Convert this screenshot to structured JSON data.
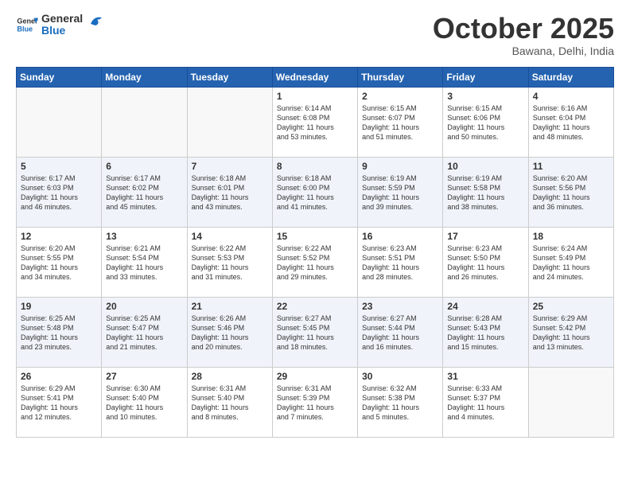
{
  "logo": {
    "text_general": "General",
    "text_blue": "Blue"
  },
  "header": {
    "month": "October 2025",
    "location": "Bawana, Delhi, India"
  },
  "weekdays": [
    "Sunday",
    "Monday",
    "Tuesday",
    "Wednesday",
    "Thursday",
    "Friday",
    "Saturday"
  ],
  "weeks": [
    [
      {
        "day": "",
        "text": ""
      },
      {
        "day": "",
        "text": ""
      },
      {
        "day": "",
        "text": ""
      },
      {
        "day": "1",
        "text": "Sunrise: 6:14 AM\nSunset: 6:08 PM\nDaylight: 11 hours\nand 53 minutes."
      },
      {
        "day": "2",
        "text": "Sunrise: 6:15 AM\nSunset: 6:07 PM\nDaylight: 11 hours\nand 51 minutes."
      },
      {
        "day": "3",
        "text": "Sunrise: 6:15 AM\nSunset: 6:06 PM\nDaylight: 11 hours\nand 50 minutes."
      },
      {
        "day": "4",
        "text": "Sunrise: 6:16 AM\nSunset: 6:04 PM\nDaylight: 11 hours\nand 48 minutes."
      }
    ],
    [
      {
        "day": "5",
        "text": "Sunrise: 6:17 AM\nSunset: 6:03 PM\nDaylight: 11 hours\nand 46 minutes."
      },
      {
        "day": "6",
        "text": "Sunrise: 6:17 AM\nSunset: 6:02 PM\nDaylight: 11 hours\nand 45 minutes."
      },
      {
        "day": "7",
        "text": "Sunrise: 6:18 AM\nSunset: 6:01 PM\nDaylight: 11 hours\nand 43 minutes."
      },
      {
        "day": "8",
        "text": "Sunrise: 6:18 AM\nSunset: 6:00 PM\nDaylight: 11 hours\nand 41 minutes."
      },
      {
        "day": "9",
        "text": "Sunrise: 6:19 AM\nSunset: 5:59 PM\nDaylight: 11 hours\nand 39 minutes."
      },
      {
        "day": "10",
        "text": "Sunrise: 6:19 AM\nSunset: 5:58 PM\nDaylight: 11 hours\nand 38 minutes."
      },
      {
        "day": "11",
        "text": "Sunrise: 6:20 AM\nSunset: 5:56 PM\nDaylight: 11 hours\nand 36 minutes."
      }
    ],
    [
      {
        "day": "12",
        "text": "Sunrise: 6:20 AM\nSunset: 5:55 PM\nDaylight: 11 hours\nand 34 minutes."
      },
      {
        "day": "13",
        "text": "Sunrise: 6:21 AM\nSunset: 5:54 PM\nDaylight: 11 hours\nand 33 minutes."
      },
      {
        "day": "14",
        "text": "Sunrise: 6:22 AM\nSunset: 5:53 PM\nDaylight: 11 hours\nand 31 minutes."
      },
      {
        "day": "15",
        "text": "Sunrise: 6:22 AM\nSunset: 5:52 PM\nDaylight: 11 hours\nand 29 minutes."
      },
      {
        "day": "16",
        "text": "Sunrise: 6:23 AM\nSunset: 5:51 PM\nDaylight: 11 hours\nand 28 minutes."
      },
      {
        "day": "17",
        "text": "Sunrise: 6:23 AM\nSunset: 5:50 PM\nDaylight: 11 hours\nand 26 minutes."
      },
      {
        "day": "18",
        "text": "Sunrise: 6:24 AM\nSunset: 5:49 PM\nDaylight: 11 hours\nand 24 minutes."
      }
    ],
    [
      {
        "day": "19",
        "text": "Sunrise: 6:25 AM\nSunset: 5:48 PM\nDaylight: 11 hours\nand 23 minutes."
      },
      {
        "day": "20",
        "text": "Sunrise: 6:25 AM\nSunset: 5:47 PM\nDaylight: 11 hours\nand 21 minutes."
      },
      {
        "day": "21",
        "text": "Sunrise: 6:26 AM\nSunset: 5:46 PM\nDaylight: 11 hours\nand 20 minutes."
      },
      {
        "day": "22",
        "text": "Sunrise: 6:27 AM\nSunset: 5:45 PM\nDaylight: 11 hours\nand 18 minutes."
      },
      {
        "day": "23",
        "text": "Sunrise: 6:27 AM\nSunset: 5:44 PM\nDaylight: 11 hours\nand 16 minutes."
      },
      {
        "day": "24",
        "text": "Sunrise: 6:28 AM\nSunset: 5:43 PM\nDaylight: 11 hours\nand 15 minutes."
      },
      {
        "day": "25",
        "text": "Sunrise: 6:29 AM\nSunset: 5:42 PM\nDaylight: 11 hours\nand 13 minutes."
      }
    ],
    [
      {
        "day": "26",
        "text": "Sunrise: 6:29 AM\nSunset: 5:41 PM\nDaylight: 11 hours\nand 12 minutes."
      },
      {
        "day": "27",
        "text": "Sunrise: 6:30 AM\nSunset: 5:40 PM\nDaylight: 11 hours\nand 10 minutes."
      },
      {
        "day": "28",
        "text": "Sunrise: 6:31 AM\nSunset: 5:40 PM\nDaylight: 11 hours\nand 8 minutes."
      },
      {
        "day": "29",
        "text": "Sunrise: 6:31 AM\nSunset: 5:39 PM\nDaylight: 11 hours\nand 7 minutes."
      },
      {
        "day": "30",
        "text": "Sunrise: 6:32 AM\nSunset: 5:38 PM\nDaylight: 11 hours\nand 5 minutes."
      },
      {
        "day": "31",
        "text": "Sunrise: 6:33 AM\nSunset: 5:37 PM\nDaylight: 11 hours\nand 4 minutes."
      },
      {
        "day": "",
        "text": ""
      }
    ]
  ]
}
